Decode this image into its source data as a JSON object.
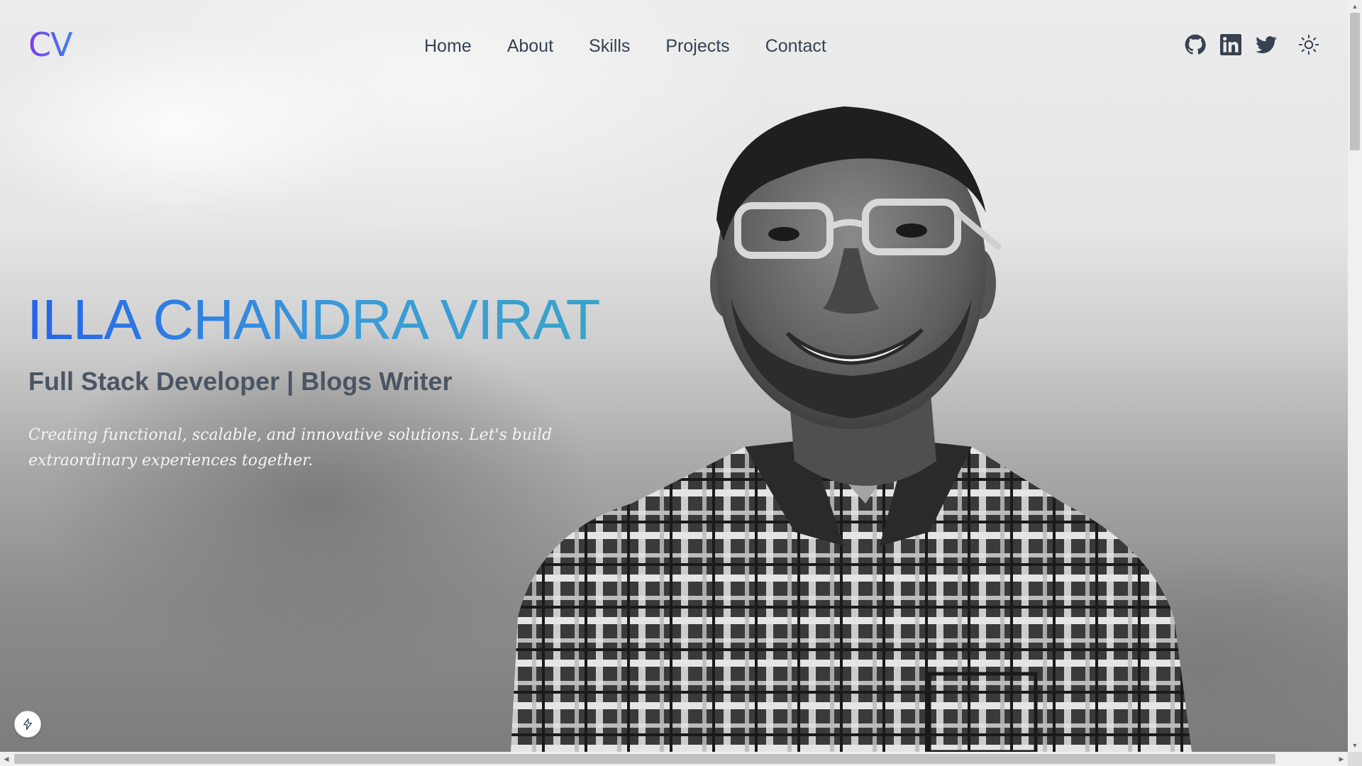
{
  "header": {
    "logo": "CV",
    "nav": [
      "Home",
      "About",
      "Skills",
      "Projects",
      "Contact"
    ],
    "socials": [
      {
        "icon": "github-icon",
        "label": "GitHub"
      },
      {
        "icon": "linkedin-icon",
        "label": "LinkedIn"
      },
      {
        "icon": "twitter-icon",
        "label": "Twitter"
      }
    ],
    "theme_toggle_icon": "sun-icon"
  },
  "hero": {
    "name": "ILLA CHANDRA VIRAT",
    "subtitle": "Full Stack Developer | Blogs Writer",
    "description": "Creating functional, scalable, and innovative solutions. Let's build extraordinary experiences together."
  },
  "badge_icon": "lightning-icon",
  "colors": {
    "logo_gradient": [
      "#7c3aed",
      "#3b82f6"
    ],
    "name_gradient": [
      "#2563eb",
      "#38a3c9"
    ],
    "nav_text": "#374151",
    "subtitle_text": "#4b5563"
  }
}
